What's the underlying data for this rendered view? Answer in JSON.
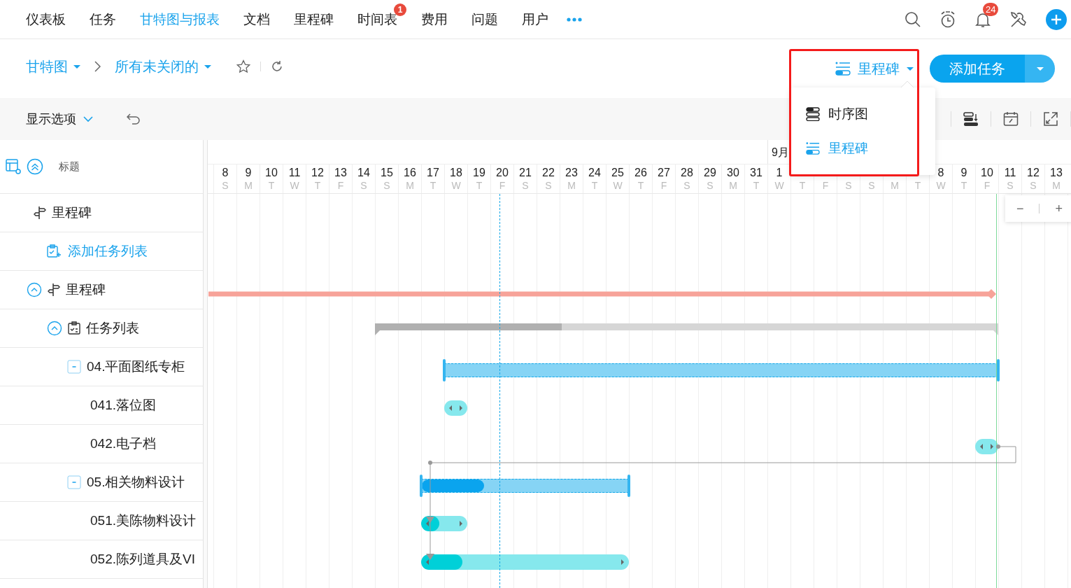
{
  "nav": {
    "items": [
      {
        "label": "仪表板",
        "selected": false
      },
      {
        "label": "任务",
        "selected": false
      },
      {
        "label": "甘特图与报表",
        "selected": true
      },
      {
        "label": "文档",
        "selected": false
      },
      {
        "label": "里程碑",
        "selected": false
      },
      {
        "label": "时间表",
        "selected": false,
        "badge": "1"
      },
      {
        "label": "费用",
        "selected": false
      },
      {
        "label": "问题",
        "selected": false
      },
      {
        "label": "用户",
        "selected": false
      }
    ],
    "notification_badge": "24"
  },
  "breadcrumb": [
    {
      "label": "甘特图"
    },
    {
      "label": "所有未关闭的"
    }
  ],
  "view_switcher": {
    "label": "里程碑",
    "highlighted": true,
    "open": true,
    "options": [
      {
        "label": "时序图",
        "selected": false
      },
      {
        "label": "里程碑",
        "selected": true
      }
    ]
  },
  "add_task_button": "添加任务",
  "toolbar": {
    "display_options": "显示选项"
  },
  "tree_header": "标题",
  "timeline": {
    "months": [
      {
        "days": [
          {
            "day": "8",
            "weekday": "S"
          },
          {
            "day": "9",
            "weekday": "M"
          },
          {
            "day": "10",
            "weekday": "T"
          },
          {
            "day": "11",
            "weekday": "W"
          },
          {
            "day": "12",
            "weekday": "T"
          },
          {
            "day": "13",
            "weekday": "F"
          },
          {
            "day": "14",
            "weekday": "S"
          },
          {
            "day": "15",
            "weekday": "S"
          },
          {
            "day": "16",
            "weekday": "M"
          },
          {
            "day": "17",
            "weekday": "T"
          },
          {
            "day": "18",
            "weekday": "W"
          },
          {
            "day": "19",
            "weekday": "T"
          },
          {
            "day": "20",
            "weekday": "F"
          },
          {
            "day": "21",
            "weekday": "S"
          },
          {
            "day": "22",
            "weekday": "S"
          },
          {
            "day": "23",
            "weekday": "M"
          },
          {
            "day": "24",
            "weekday": "T"
          },
          {
            "day": "25",
            "weekday": "W"
          },
          {
            "day": "26",
            "weekday": "T"
          },
          {
            "day": "27",
            "weekday": "F"
          },
          {
            "day": "28",
            "weekday": "S"
          },
          {
            "day": "29",
            "weekday": "S"
          },
          {
            "day": "30",
            "weekday": "M"
          },
          {
            "day": "31",
            "weekday": "T"
          }
        ]
      },
      {
        "label": "9月",
        "days": [
          {
            "day": "1",
            "weekday": "W"
          },
          {
            "weekday": "T"
          },
          {
            "weekday": "F"
          },
          {
            "weekday": "S"
          },
          {
            "weekday": "S"
          },
          {
            "weekday": "M"
          },
          {
            "weekday": "T"
          },
          {
            "day": "8",
            "weekday": "W"
          },
          {
            "day": "9",
            "weekday": "T"
          },
          {
            "day": "10",
            "weekday": "F"
          },
          {
            "day": "11",
            "weekday": "S"
          },
          {
            "day": "12",
            "weekday": "S"
          },
          {
            "day": "13",
            "weekday": "M"
          }
        ]
      }
    ]
  },
  "zoom": {
    "minus": "−",
    "plus": "+"
  },
  "tree": [
    {
      "kind": "milestone",
      "label": "里程碑",
      "children": [
        {
          "kind": "add-link",
          "label": "添加任务列表"
        }
      ]
    },
    {
      "kind": "milestone",
      "label": "里程碑",
      "expanded": true,
      "bar": {
        "kind": "milestone"
      },
      "children": [
        {
          "kind": "tasklist",
          "label": "任务列表",
          "expanded": true,
          "bar": {
            "kind": "summary",
            "level": 0.3
          },
          "children": [
            {
              "kind": "group",
              "label": "04.平面图纸专柜",
              "expanded": true,
              "bar": {
                "kind": "group"
              },
              "children": [
                {
                  "kind": "task",
                  "label": "041.落位图",
                  "bar": {
                    "kind": "task"
                  }
                },
                {
                  "kind": "task",
                  "label": "042.电子档",
                  "bar": {
                    "kind": "task"
                  }
                }
              ]
            },
            {
              "kind": "group",
              "label": "05.相关物料设计",
              "expanded": true,
              "bar": {
                "kind": "group",
                "level": 0.3
              },
              "children": [
                {
                  "kind": "task",
                  "label": "051.美陈物料设计",
                  "bar": {
                    "kind": "task",
                    "level": 0.4
                  }
                },
                {
                  "kind": "task",
                  "label": "052.陈列道具及VI",
                  "bar": {
                    "kind": "task",
                    "level": 0.2
                  }
                }
              ]
            }
          ]
        }
      ]
    }
  ]
}
